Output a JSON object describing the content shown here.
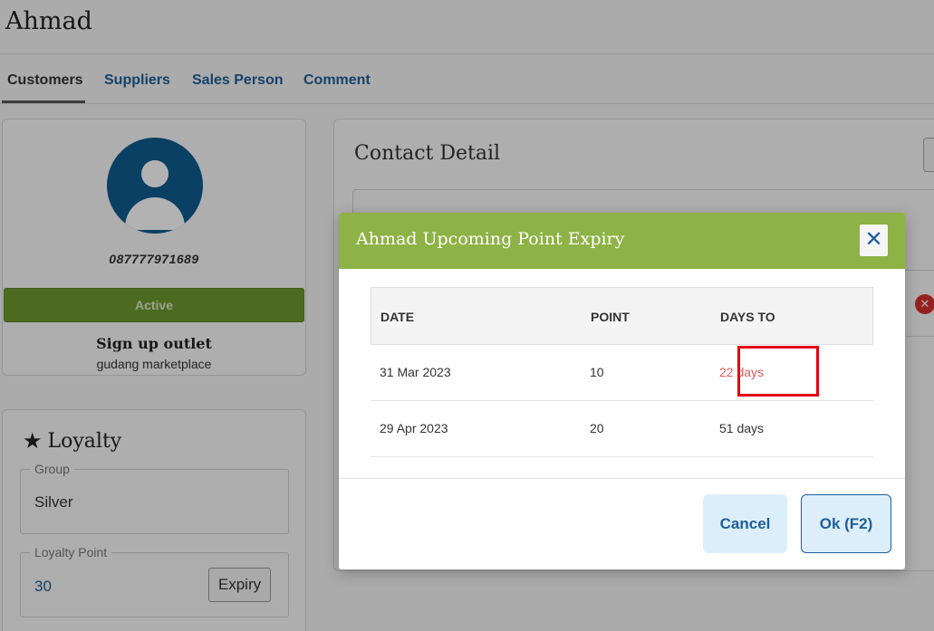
{
  "page": {
    "title": "Ahmad"
  },
  "tabs": [
    {
      "label": "Customers"
    },
    {
      "label": "Suppliers"
    },
    {
      "label": "Sales Person"
    },
    {
      "label": "Comment"
    }
  ],
  "profile": {
    "phone": "087777971689",
    "status": "Active",
    "signup_label": "Sign up outlet",
    "signup_outlet": "gudang marketplace"
  },
  "loyalty": {
    "title": "Loyalty",
    "group_label": "Group",
    "group_value": "Silver",
    "point_label": "Loyalty Point",
    "point_value": "30",
    "expiry_button": "Expiry"
  },
  "contact": {
    "title": "Contact Detail"
  },
  "modal": {
    "title": "Ahmad Upcoming Point Expiry",
    "close_icon": "close-icon",
    "columns": [
      "DATE",
      "POINT",
      "DAYS TO"
    ],
    "rows": [
      {
        "date": "31 Mar 2023",
        "point": "10",
        "days": "22 days"
      },
      {
        "date": "29 Apr 2023",
        "point": "20",
        "days": "51 days"
      }
    ],
    "cancel_label": "Cancel",
    "ok_label": "Ok (F2)"
  },
  "colors": {
    "accent": "#8db245",
    "status_green": "#6f9a2f",
    "link_blue": "#1e5f9a",
    "warning_red": "#e05b5b"
  }
}
